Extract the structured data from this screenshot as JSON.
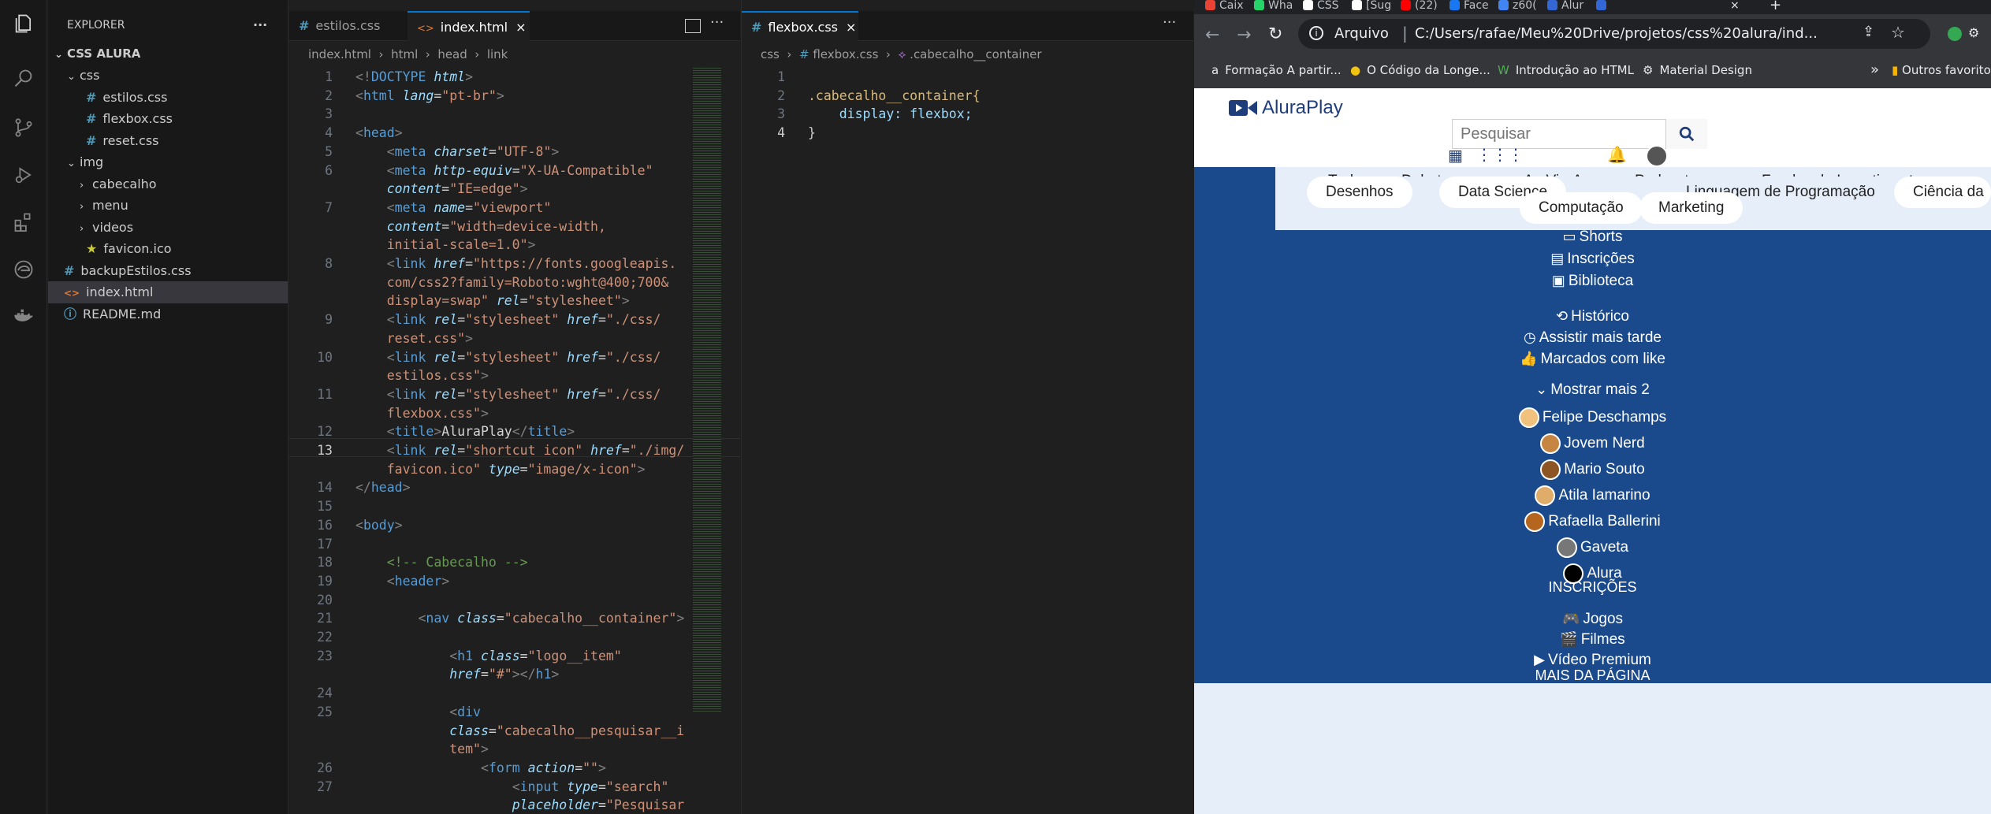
{
  "explorer": {
    "title": "EXPLORER",
    "more": "···",
    "folder": "CSS ALURA",
    "items": [
      {
        "label": "css",
        "kind": "folder"
      },
      {
        "label": "estilos.css",
        "kind": "css"
      },
      {
        "label": "flexbox.css",
        "kind": "css"
      },
      {
        "label": "reset.css",
        "kind": "css"
      },
      {
        "label": "img",
        "kind": "folder"
      },
      {
        "label": "cabecalho",
        "kind": "sub"
      },
      {
        "label": "menu",
        "kind": "sub"
      },
      {
        "label": "videos",
        "kind": "sub"
      },
      {
        "label": "favicon.ico",
        "kind": "ico"
      },
      {
        "label": "backupEstilos.css",
        "kind": "css"
      },
      {
        "label": "index.html",
        "kind": "html"
      },
      {
        "label": "README.md",
        "kind": "md"
      }
    ]
  },
  "editor1": {
    "tabs": [
      {
        "label": "estilos.css",
        "icon": "#"
      },
      {
        "label": "index.html",
        "icon": "<>",
        "close": "×"
      }
    ],
    "breadcrumb": [
      "index.html",
      "html",
      "head",
      "link"
    ],
    "line_numbers": [
      "1",
      "2",
      "3",
      "4",
      "5",
      "6",
      "",
      "7",
      "",
      "",
      "8",
      "",
      "",
      "9",
      "",
      "10",
      "",
      "11",
      "",
      "12",
      "13",
      "",
      "14",
      "15",
      "16",
      "17",
      "18",
      "19",
      "20",
      "21",
      "22",
      "23",
      "",
      "24",
      "25",
      "",
      "",
      "26",
      "27",
      ""
    ],
    "current_line": "13"
  },
  "editor2": {
    "tab": "flexbox.css",
    "close": "×",
    "breadcrumb": [
      "css",
      "flexbox.css",
      ".cabecalho__container"
    ],
    "line_numbers": [
      "1",
      "2",
      "3",
      "4"
    ],
    "lines": [
      "",
      ".cabecalho__container{",
      "    display: flexbox;",
      "}"
    ]
  },
  "chrome": {
    "tabs": [
      "Caix",
      "Wha",
      "CSS",
      "[Sug",
      "(22)",
      "Face",
      "z60(",
      "Alur",
      ""
    ],
    "address": {
      "scheme": "Arquivo",
      "url": "C:/Users/rafae/Meu%20Drive/projetos/css%20alura/ind..."
    },
    "bookmarks": [
      "Formação A partir...",
      "O Código da Longe...",
      "Introdução ao HTML",
      "Material Design"
    ],
    "bookmarks_more": "»",
    "other_favorites": "Outros favoritos"
  },
  "site": {
    "logo": "AluraPlay",
    "search_placeholder": "Pesquisar",
    "chips_row1": [
      "Tudo",
      "Debates",
      "Ao Vivo",
      "Apps",
      "Podcasts",
      "Fundos de Investimento"
    ],
    "chips_row2": [
      "Desenhos",
      "Data Science",
      "Computação",
      "Linguagem de Programação",
      "Marketing",
      "Ciência da"
    ],
    "menu": [
      "Shorts",
      "Inscrições",
      "Biblioteca",
      "Histórico",
      "Assistir mais tarde",
      "Marcados com like"
    ],
    "show_more": "Mostrar mais 2",
    "channels": [
      "Felipe Deschamps",
      "Jovem Nerd",
      "Mario Souto",
      "Atila Iamarino",
      "Rafaella Ballerini",
      "Gaveta",
      "Alura"
    ],
    "subs_heading": "INSCRIÇÕES",
    "extras": [
      "Jogos",
      "Filmes",
      "Vídeo Premium"
    ],
    "more_heading": "MAIS DA PÁGINA"
  }
}
